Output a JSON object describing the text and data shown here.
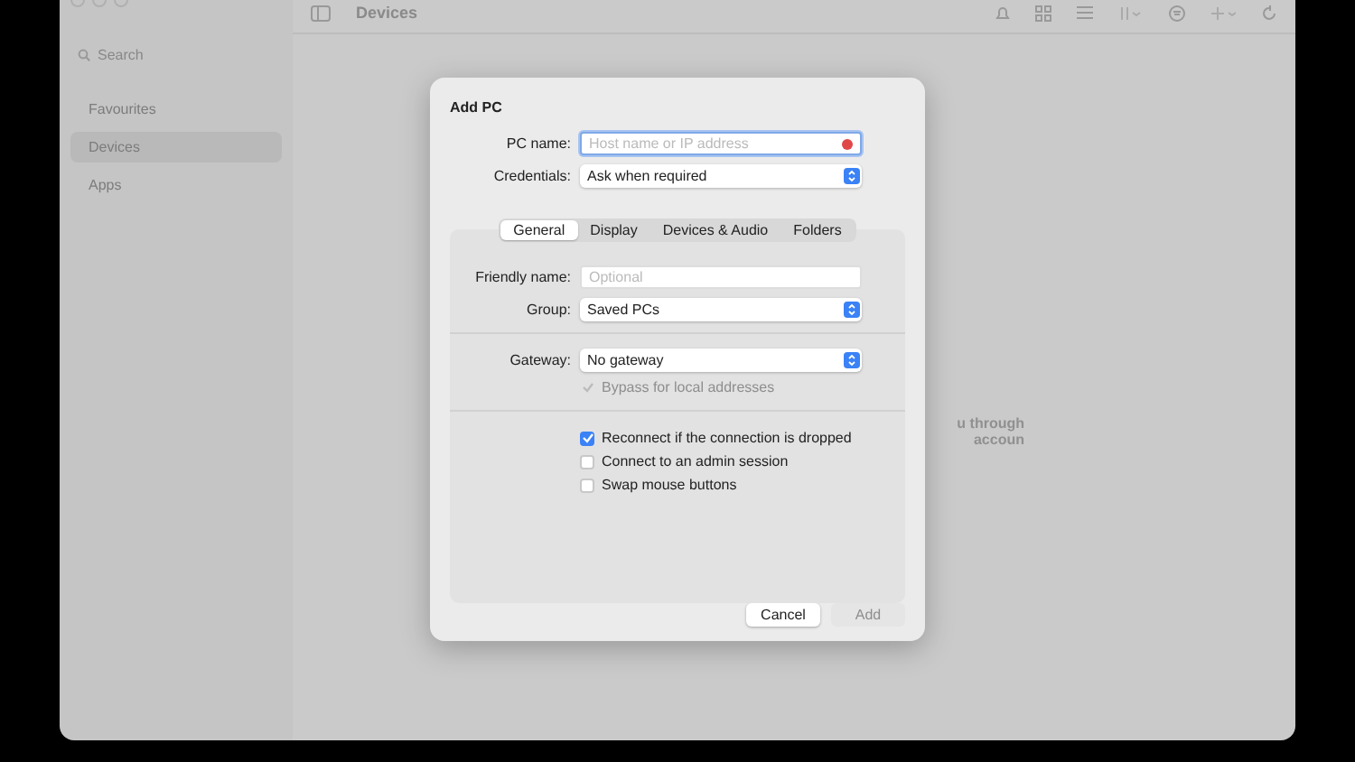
{
  "sidebar": {
    "search": {
      "placeholder": "Search"
    },
    "items": [
      {
        "label": "Favourites",
        "selected": false
      },
      {
        "label": "Devices",
        "selected": true
      },
      {
        "label": "Apps",
        "selected": false
      }
    ]
  },
  "toolbar": {
    "title": "Devices"
  },
  "background_text": [
    "u through",
    "accoun"
  ],
  "dialog": {
    "title": "Add PC",
    "fields": [
      {
        "kind": "text",
        "label": "PC name:",
        "placeholder": "Host name or IP address",
        "focused": true,
        "error": true
      },
      {
        "kind": "select",
        "label": "Credentials:",
        "value": "Ask when required"
      }
    ],
    "tabs": [
      {
        "label": "General",
        "selected": true
      },
      {
        "label": "Display",
        "selected": false
      },
      {
        "label": "Devices & Audio",
        "selected": false
      },
      {
        "label": "Folders",
        "selected": false
      }
    ],
    "general": {
      "fields": [
        {
          "kind": "text",
          "label": "Friendly name:",
          "placeholder": "Optional"
        },
        {
          "kind": "select",
          "label": "Group:",
          "value": "Saved PCs"
        }
      ],
      "gateway": {
        "label": "Gateway:",
        "value": "No gateway"
      },
      "bypass": {
        "label": "Bypass for local addresses",
        "checked": true,
        "disabled": true
      },
      "options": [
        {
          "label": "Reconnect if the connection is dropped",
          "checked": true,
          "disabled": false
        },
        {
          "label": "Connect to an admin session",
          "checked": false,
          "disabled": false
        },
        {
          "label": "Swap mouse buttons",
          "checked": false,
          "disabled": false
        }
      ]
    },
    "buttons": [
      {
        "label": "Cancel",
        "disabled": false
      },
      {
        "label": "Add",
        "disabled": true
      }
    ]
  }
}
